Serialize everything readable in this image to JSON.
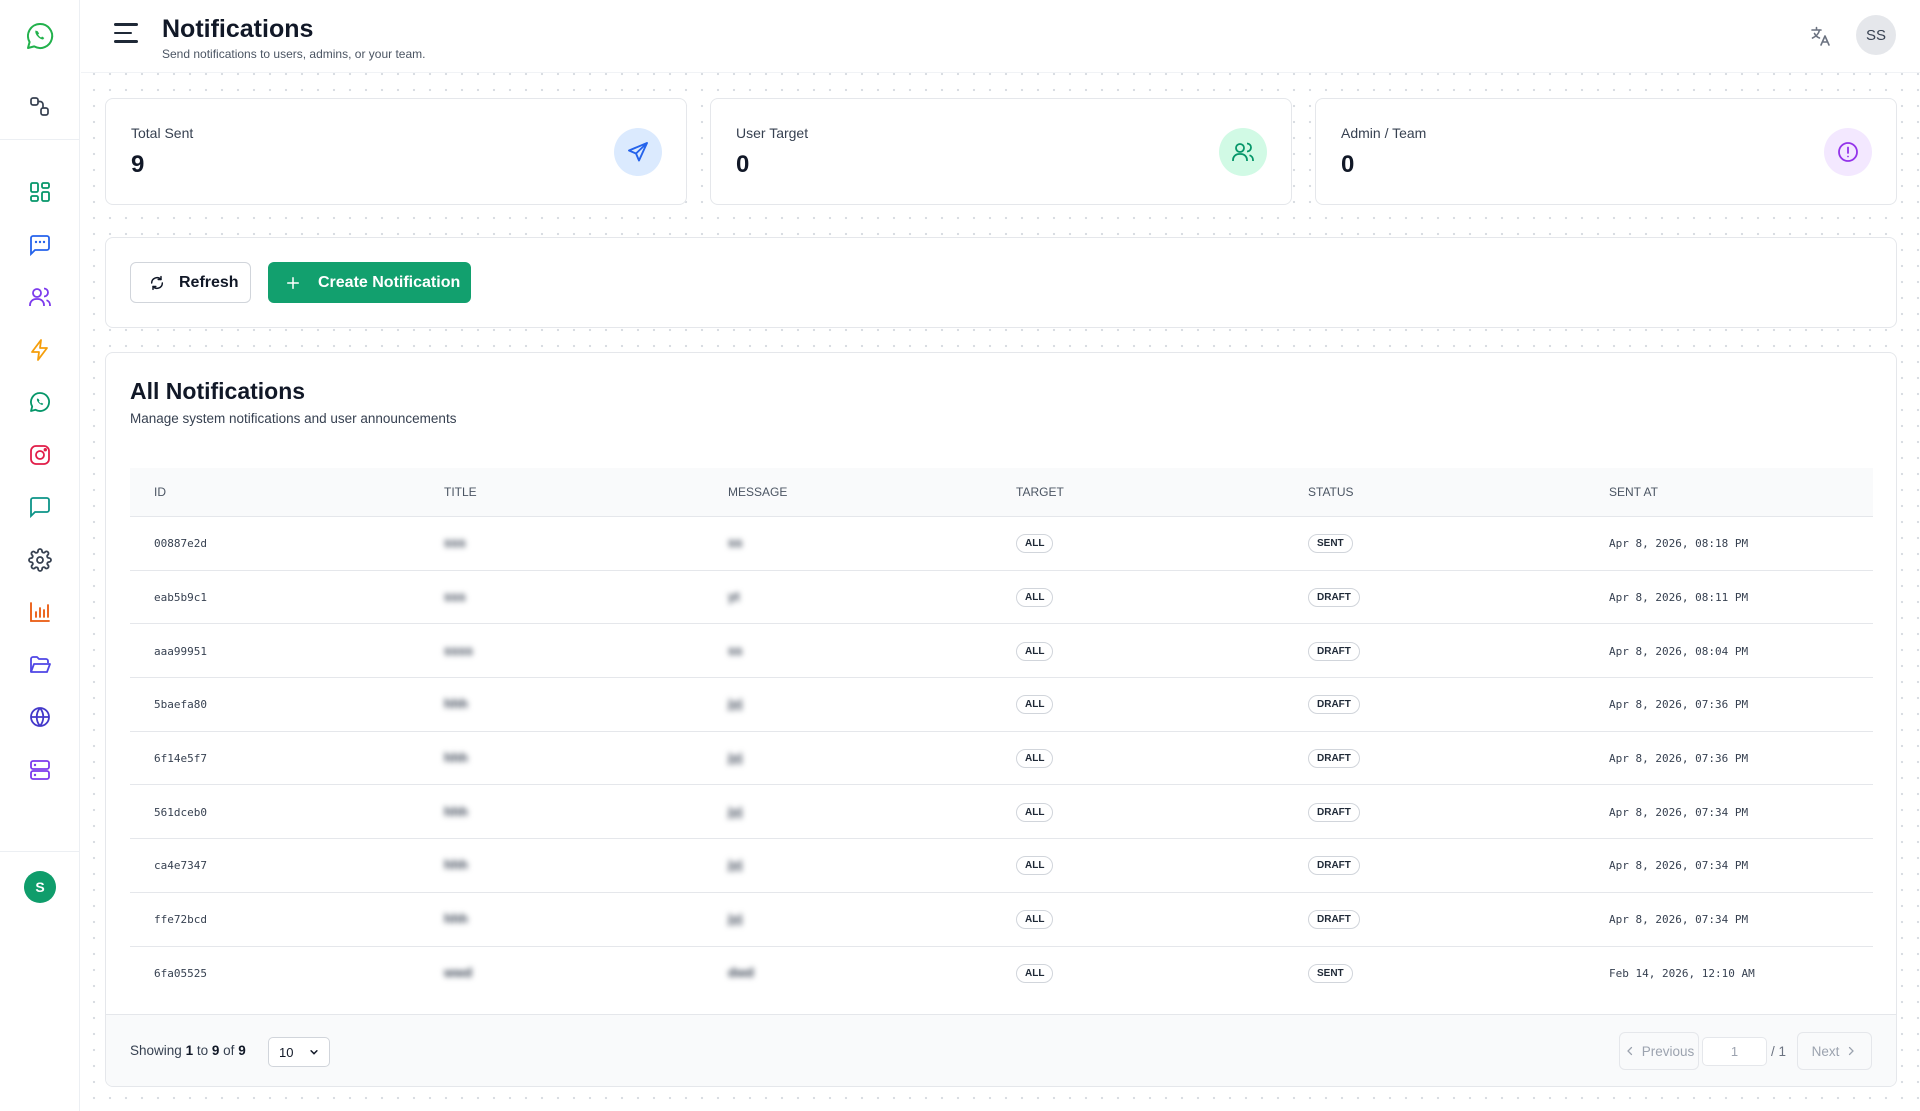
{
  "header": {
    "title": "Notifications",
    "subtitle": "Send notifications to users, admins, or your team.",
    "user_initials": "SS"
  },
  "sidebar": {
    "bottom_avatar": "S",
    "items": [
      {
        "icon": "dashboard-icon",
        "color": "#059669"
      },
      {
        "icon": "message-square-text-icon",
        "color": "#2563eb"
      },
      {
        "icon": "users-icon",
        "color": "#7c3aed"
      },
      {
        "icon": "zap-icon",
        "color": "#f59e0b"
      },
      {
        "icon": "whatsapp-icon",
        "color": "#059669"
      },
      {
        "icon": "instagram-icon",
        "color": "#e11d48"
      },
      {
        "icon": "message-square-icon",
        "color": "#0d9488"
      },
      {
        "icon": "settings-icon",
        "color": "#374151"
      },
      {
        "icon": "bar-chart-icon",
        "color": "#ea580c"
      },
      {
        "icon": "folder-open-icon",
        "color": "#4f46e5"
      },
      {
        "icon": "globe-icon",
        "color": "#4338ca"
      },
      {
        "icon": "server-icon",
        "color": "#7c3aed"
      }
    ]
  },
  "stats": [
    {
      "label": "Total Sent",
      "value": "9",
      "icon": "send-icon",
      "color": "#2563eb",
      "bg": "#dbeafe"
    },
    {
      "label": "User Target",
      "value": "0",
      "icon": "users-icon",
      "color": "#059669",
      "bg": "#d1fae5"
    },
    {
      "label": "Admin / Team",
      "value": "0",
      "icon": "alert-circle-icon",
      "color": "#9333ea",
      "bg": "#f3e8ff"
    }
  ],
  "actions": {
    "refresh_label": "Refresh",
    "create_label": "Create Notification"
  },
  "table": {
    "title": "All Notifications",
    "subtitle": "Manage system notifications and user announcements",
    "columns": [
      "ID",
      "TITLE",
      "MESSAGE",
      "TARGET",
      "STATUS",
      "SENT AT"
    ],
    "rows": [
      {
        "id": "00887e2d",
        "title": "sss",
        "message": "ss",
        "target": "ALL",
        "status": "SENT",
        "sent_at": "Apr 8, 2026, 08:18 PM"
      },
      {
        "id": "eab5b9c1",
        "title": "sss",
        "message": "yt",
        "target": "ALL",
        "status": "DRAFT",
        "sent_at": "Apr 8, 2026, 08:11 PM"
      },
      {
        "id": "aaa99951",
        "title": "ssss",
        "message": "ss",
        "target": "ALL",
        "status": "DRAFT",
        "sent_at": "Apr 8, 2026, 08:04 PM"
      },
      {
        "id": "5baefa80",
        "title": "hhh",
        "message": "jyj",
        "target": "ALL",
        "status": "DRAFT",
        "sent_at": "Apr 8, 2026, 07:36 PM"
      },
      {
        "id": "6f14e5f7",
        "title": "hhh",
        "message": "jyj",
        "target": "ALL",
        "status": "DRAFT",
        "sent_at": "Apr 8, 2026, 07:36 PM"
      },
      {
        "id": "561dceb0",
        "title": "hhh",
        "message": "jyj",
        "target": "ALL",
        "status": "DRAFT",
        "sent_at": "Apr 8, 2026, 07:34 PM"
      },
      {
        "id": "ca4e7347",
        "title": "hhh",
        "message": "jyj",
        "target": "ALL",
        "status": "DRAFT",
        "sent_at": "Apr 8, 2026, 07:34 PM"
      },
      {
        "id": "ffe72bcd",
        "title": "hhh",
        "message": "jyj",
        "target": "ALL",
        "status": "DRAFT",
        "sent_at": "Apr 8, 2026, 07:34 PM"
      },
      {
        "id": "6fa05525",
        "title": "wwd",
        "message": "dwd",
        "target": "ALL",
        "status": "SENT",
        "sent_at": "Feb 14, 2026, 12:10 AM"
      }
    ]
  },
  "pagination": {
    "showing_prefix": "Showing",
    "from": "1",
    "to_word": "to",
    "to": "9",
    "of_word": "of",
    "total": "9",
    "page_size": "10",
    "previous_label": "Previous",
    "page": "1",
    "total_pages": "/ 1",
    "next_label": "Next"
  }
}
